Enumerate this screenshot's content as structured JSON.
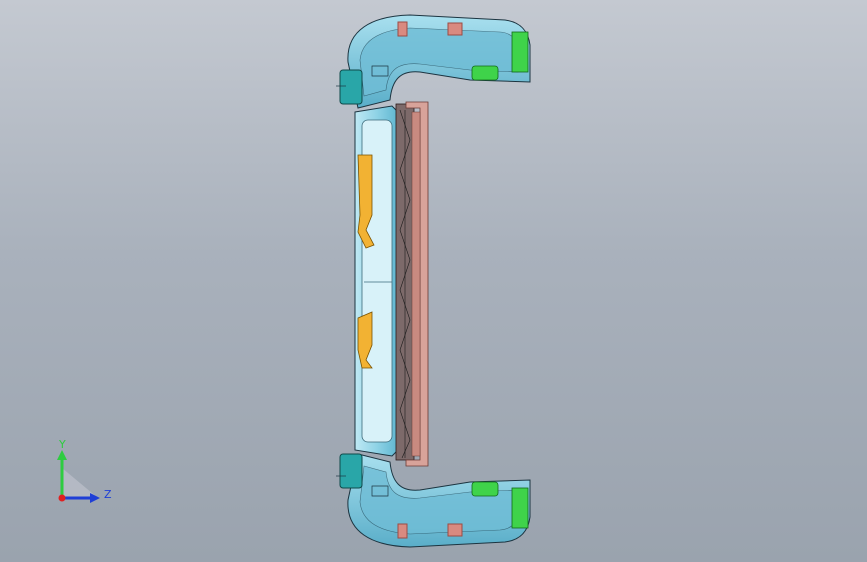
{
  "viewport": {
    "background_top": "#c4c9d1",
    "background_bottom": "#9aa3ae"
  },
  "model": {
    "colors": {
      "shell": "#8fd3e6",
      "shell_inner": "#6fbdd6",
      "shell_edge": "#1c3440",
      "bracket_red": "#d98a80",
      "bracket_red_dark": "#9c4b43",
      "clip_yellow": "#f2b233",
      "clip_green": "#3fd34a",
      "clip_teal": "#29a6a8",
      "rail_pink": "#d8a39a"
    }
  },
  "triad": {
    "y_label": "Y",
    "z_label": "Z",
    "y_color": "#2ecc40",
    "z_color": "#1f3fd6",
    "x_color": "#e02020"
  }
}
